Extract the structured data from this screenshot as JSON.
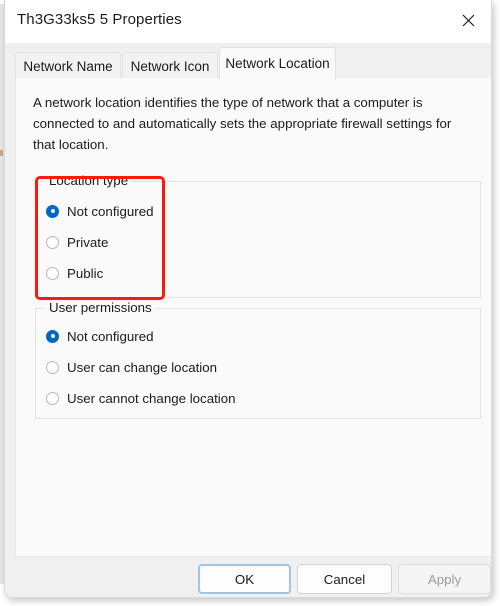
{
  "window": {
    "title": "Th3G33ks5 5 Properties",
    "close_icon": "close-icon"
  },
  "tabs": [
    {
      "label": "Network Name",
      "selected": false
    },
    {
      "label": "Network Icon",
      "selected": false
    },
    {
      "label": "Network Location",
      "selected": true
    }
  ],
  "content": {
    "description": "A network location identifies the type of network that a computer is connected to and automatically sets the appropriate firewall settings for that location.",
    "groups": [
      {
        "label": "Location type",
        "options": [
          {
            "label": "Not configured",
            "checked": true
          },
          {
            "label": "Private",
            "checked": false
          },
          {
            "label": "Public",
            "checked": false
          }
        ]
      },
      {
        "label": "User permissions",
        "options": [
          {
            "label": "Not configured",
            "checked": true
          },
          {
            "label": "User can change location",
            "checked": false
          },
          {
            "label": "User cannot change location",
            "checked": false
          }
        ]
      }
    ]
  },
  "footer": {
    "ok_label": "OK",
    "cancel_label": "Cancel",
    "apply_label": "Apply",
    "apply_disabled": true
  },
  "annotation": {
    "type": "rectangle-highlight",
    "color": "#f81b12",
    "target": "Location type group"
  },
  "colors": {
    "accent": "#0067c0",
    "annotation_red": "#f81b12",
    "dialog_background": "#f0f0f0",
    "panel_background": "#fafafa",
    "focus_border": "#9cc7ea"
  }
}
